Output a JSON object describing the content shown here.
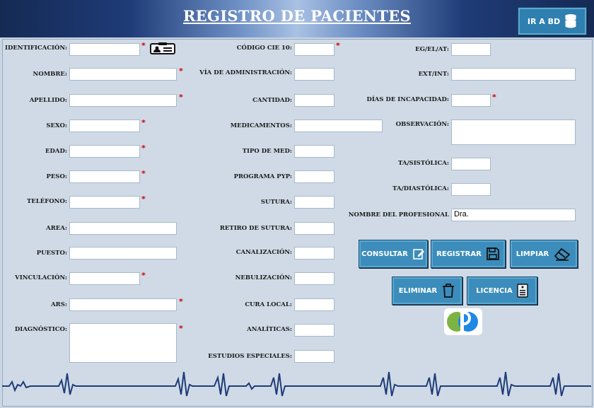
{
  "header": {
    "title": "REGISTRO DE PACIENTES",
    "ir_bd_label": "IR A BD"
  },
  "fields": {
    "identificacion": "IDENTIFICACIÓN:",
    "nombre": "NOMBRE:",
    "apellido": "APELLIDO:",
    "sexo": "SEXO:",
    "edad": "EDAD:",
    "peso": "PESO:",
    "telefono": "TELÉFONO:",
    "area": "AREA:",
    "puesto": "PUESTO:",
    "vinculacion": "VINCULACIÓN:",
    "ars": "ARS:",
    "diagnostico": "DIAGNÓSTICO:",
    "codigo_cie": "CÓDIGO CIE 10:",
    "via_admin": "VÍA DE ADMINISTRACIÓN:",
    "cantidad": "CANTIDAD:",
    "medicamentos": "MEDICAMENTOS:",
    "tipo_med": "TIPO DE MED:",
    "programa_pyp": "PROGRAMA PYP:",
    "sutura": "SUTURA:",
    "retiro_sutura": "RETIRO DE SUTURA:",
    "canalizacion": "CANALIZACIÓN:",
    "nebulizacion": "NEBULIZACIÓN:",
    "cura_local": "CURA LOCAL:",
    "analiticas": "ANALÍTICAS:",
    "estudios_especiales": "ESTUDIOS ESPECIALES:",
    "eg_el_at": "EG/EL/AT:",
    "ext_int": "EXT/INT:",
    "dias_incapacidad": "DÍAS DE INCAPACIDAD:",
    "observacion": "OBSERVACIÓN:",
    "ta_sistolica": "TA/SISTÓLICA:",
    "ta_diastolica": "TA/DIASTÓLICA:",
    "nombre_profesional": "NOMBRE DEL PROFESIONAL"
  },
  "values": {
    "nombre_profesional": "Dra."
  },
  "required_mark": "*",
  "buttons": {
    "consultar": "CONSULTAR",
    "registrar": "REGISTRAR",
    "limpiar": "LIMPIAR",
    "eliminar": "ELIMINAR",
    "licencia": "LICENCIA"
  },
  "colors": {
    "header_dark": "#152a54",
    "button": "#3c8dbc",
    "required": "#d00000",
    "ecg_line": "#1f3c78"
  },
  "icons": [
    "id-card-icon",
    "database-icon",
    "edit-icon",
    "save-icon",
    "eraser-icon",
    "trash-icon",
    "document-icon",
    "logo-icon"
  ]
}
